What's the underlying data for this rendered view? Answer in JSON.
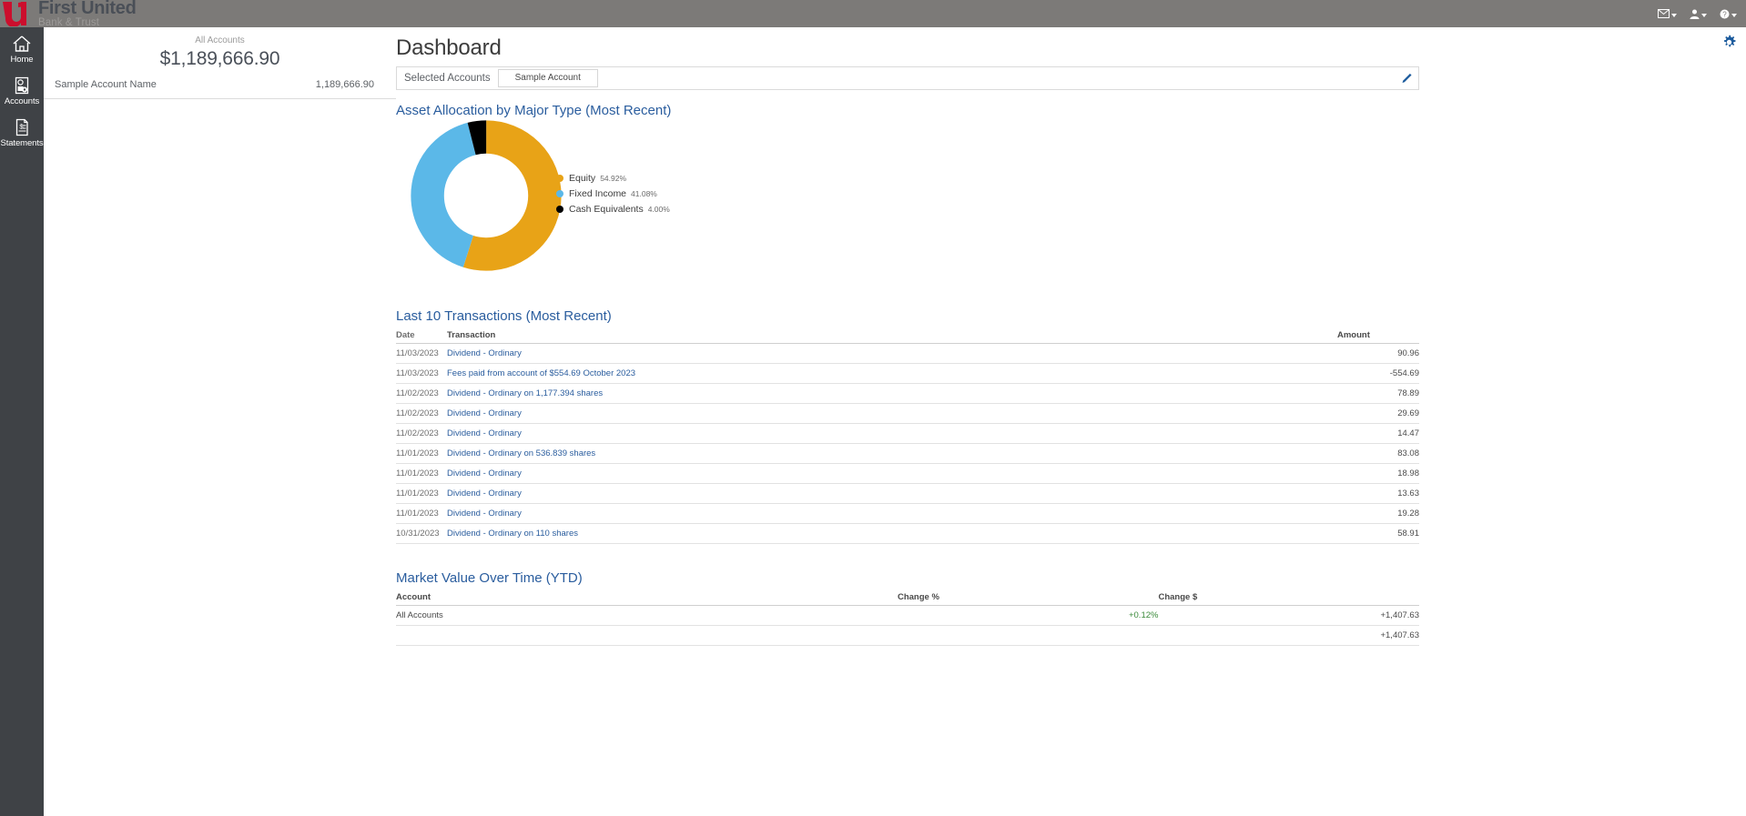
{
  "brand": {
    "name": "First United",
    "tagline": "Bank & Trust",
    "logo_mark": "u1-logo",
    "red": "#cc0e2d",
    "bar_gray": "#7c7a78",
    "rail_gray": "#3f4246",
    "link_blue": "#2a5d9e"
  },
  "topbar": {
    "icons": [
      {
        "name": "mail-icon",
        "glyph": "envelope"
      },
      {
        "name": "user-icon",
        "glyph": "person"
      },
      {
        "name": "help-icon",
        "glyph": "question-circle"
      }
    ]
  },
  "sidebar": {
    "items": [
      {
        "label": "Home",
        "icon": "home-icon"
      },
      {
        "label": "Accounts",
        "icon": "accounts-icon"
      },
      {
        "label": "Statements",
        "icon": "statements-icon"
      }
    ]
  },
  "accounts_panel": {
    "total_label": "All Accounts",
    "total_value": "$1,189,666.90",
    "rows": [
      {
        "name": "Sample Account Name",
        "amount": "1,189,666.90"
      }
    ]
  },
  "main": {
    "page_title": "Dashboard",
    "gear_icon": "gear-icon",
    "selected_accounts": {
      "label": "Selected Accounts",
      "chips": [
        "Sample Account"
      ],
      "edit_icon": "pencil-icon"
    },
    "asset_section_title": "Asset Allocation by Major Type (Most Recent)",
    "transactions_section_title": "Last 10 Transactions (Most Recent)",
    "market_value_section_title": "Market Value Over Time (YTD)"
  },
  "transactions": {
    "columns": [
      "Date",
      "Transaction",
      "Amount"
    ],
    "rows": [
      {
        "date": "11/03/2023",
        "transaction": "Dividend - Ordinary",
        "amount": "90.96"
      },
      {
        "date": "11/03/2023",
        "transaction": "Fees paid from account of $554.69 October 2023",
        "amount": "-554.69"
      },
      {
        "date": "11/02/2023",
        "transaction": "Dividend - Ordinary on 1,177.394 shares",
        "amount": "78.89"
      },
      {
        "date": "11/02/2023",
        "transaction": "Dividend - Ordinary",
        "amount": "29.69"
      },
      {
        "date": "11/02/2023",
        "transaction": "Dividend - Ordinary",
        "amount": "14.47"
      },
      {
        "date": "11/01/2023",
        "transaction": "Dividend - Ordinary on 536.839 shares",
        "amount": "83.08"
      },
      {
        "date": "11/01/2023",
        "transaction": "Dividend - Ordinary",
        "amount": "18.98"
      },
      {
        "date": "11/01/2023",
        "transaction": "Dividend - Ordinary",
        "amount": "13.63"
      },
      {
        "date": "11/01/2023",
        "transaction": "Dividend - Ordinary",
        "amount": "19.28"
      },
      {
        "date": "10/31/2023",
        "transaction": "Dividend - Ordinary on 110 shares",
        "amount": "58.91"
      }
    ]
  },
  "market_value": {
    "columns": [
      "Account",
      "Change %",
      "Change $"
    ],
    "rows": [
      {
        "account": "All Accounts",
        "change_pct": "+0.12%",
        "change_dollar": "+1,407.63"
      }
    ],
    "total": {
      "account": "",
      "change_pct": "",
      "change_dollar": "+1,407.63"
    }
  },
  "chart_data": {
    "type": "pie",
    "title": "Asset Allocation by Major Type (Most Recent)",
    "variant": "donut",
    "legend_position": "right",
    "categories": [
      "Equity",
      "Fixed Income",
      "Cash Equivalents"
    ],
    "values": [
      54.92,
      41.08,
      4.0
    ],
    "value_labels": [
      "54.92%",
      "41.08%",
      "4.00%"
    ],
    "colors": [
      "#e8a317",
      "#5bb8e8",
      "#000000"
    ],
    "units": "percent"
  }
}
